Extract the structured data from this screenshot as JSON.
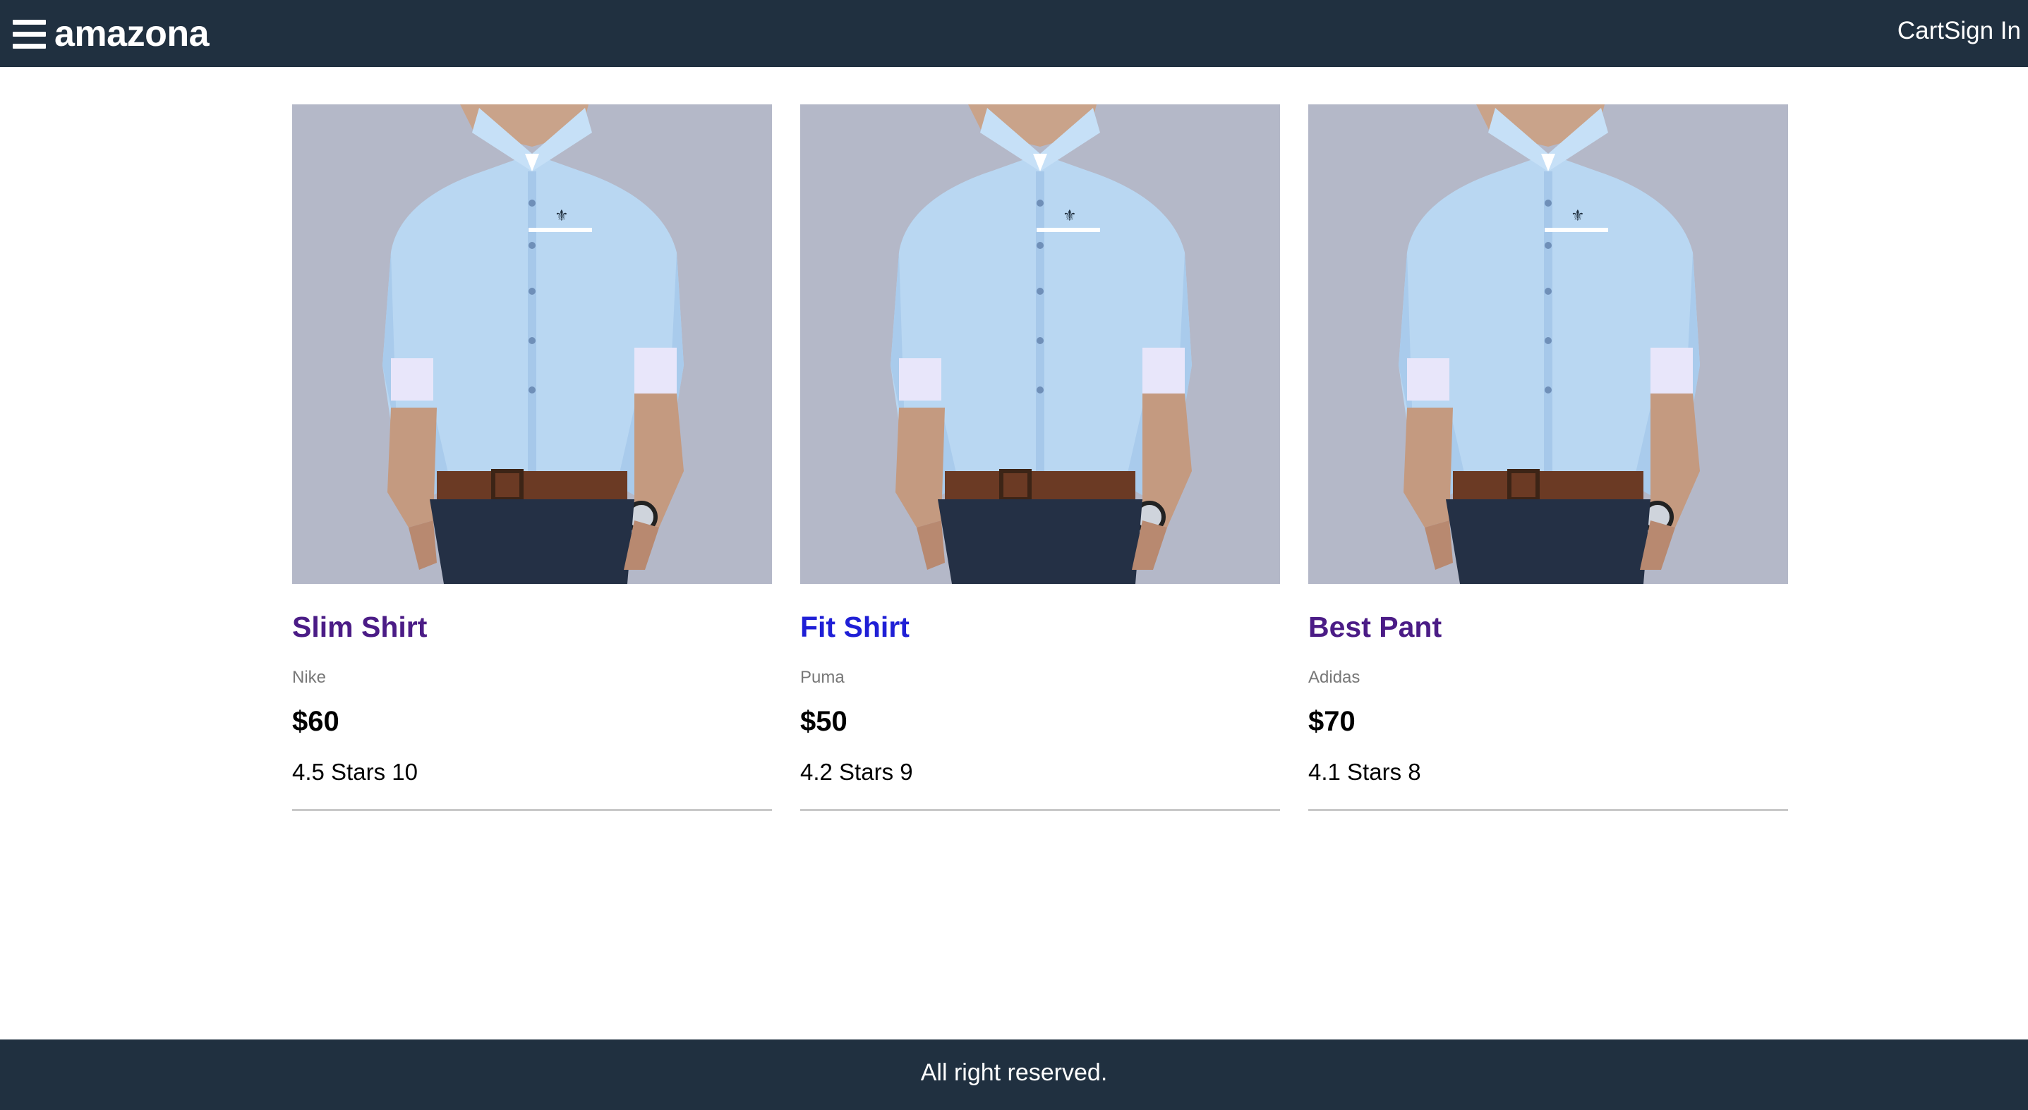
{
  "header": {
    "brand": "amazona",
    "cart_label": "Cart",
    "signin_label": "Sign In"
  },
  "products": [
    {
      "name": "Slim Shirt",
      "brand": "Nike",
      "price": "$60",
      "rating": "4.5 Stars 10",
      "name_color": "#4b1c86"
    },
    {
      "name": "Fit Shirt",
      "brand": "Puma",
      "price": "$50",
      "rating": "4.2 Stars 9",
      "name_color": "#1f1fd6"
    },
    {
      "name": "Best Pant",
      "brand": "Adidas",
      "price": "$70",
      "rating": "4.1 Stars 8",
      "name_color": "#4b1c86"
    }
  ],
  "footer": {
    "text": "All right reserved."
  },
  "colors": {
    "header_bg": "#203040",
    "footer_bg": "#203040",
    "divider": "#c8c8c8"
  },
  "icons": {
    "menu": "hamburger-menu-icon"
  }
}
